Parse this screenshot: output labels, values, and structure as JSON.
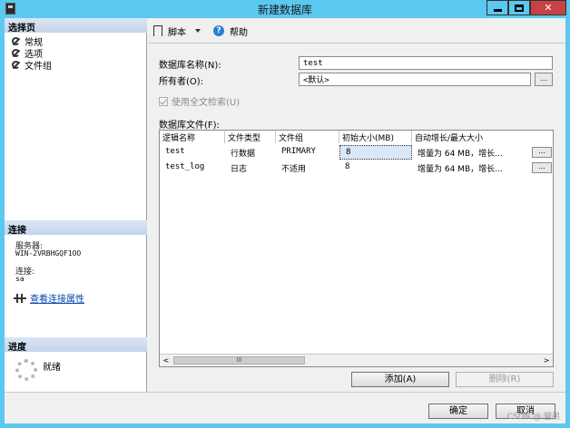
{
  "window": {
    "title": "新建数据库"
  },
  "left_panel": {
    "select_page_header": "选择页",
    "nav_items": [
      {
        "label": "常规",
        "icon": "wrench-icon"
      },
      {
        "label": "选项",
        "icon": "wrench-icon"
      },
      {
        "label": "文件组",
        "icon": "wrench-icon"
      }
    ],
    "connection_header": "连接",
    "server_label": "服务器:",
    "server_value": "WIN-2VRBHGQF1OO",
    "connection_label": "连接:",
    "connection_value": "sa",
    "view_connection_link": "查看连接属性",
    "progress_header": "进度",
    "progress_status": "就绪"
  },
  "toolbar": {
    "script_label": "脚本",
    "help_label": "帮助"
  },
  "form": {
    "db_name_label": "数据库名称(N):",
    "db_name_value": "test",
    "owner_label": "所有者(O):",
    "owner_value": "<默认>",
    "owner_browse": "...",
    "fulltext_label": "使用全文检索(U)",
    "db_files_label": "数据库文件(F):"
  },
  "grid": {
    "columns": [
      "逻辑名称",
      "文件类型",
      "文件组",
      "初始大小(MB)",
      "自动增长/最大大小"
    ],
    "rows": [
      {
        "logical_name": "test",
        "file_type": "行数据",
        "filegroup": "PRIMARY",
        "initial_size": "8",
        "autogrowth": "增量为 64 MB，增长...",
        "btn": "..."
      },
      {
        "logical_name": "test_log",
        "file_type": "日志",
        "filegroup": "不适用",
        "initial_size": "8",
        "autogrowth": "增量为 64 MB，增长...",
        "btn": "..."
      }
    ],
    "scroll_thumb": "III"
  },
  "buttons": {
    "add": "添加(A)",
    "remove": "删除(R)",
    "ok": "确定",
    "cancel": "取消"
  },
  "watermark": "CSDN @ 管弟"
}
